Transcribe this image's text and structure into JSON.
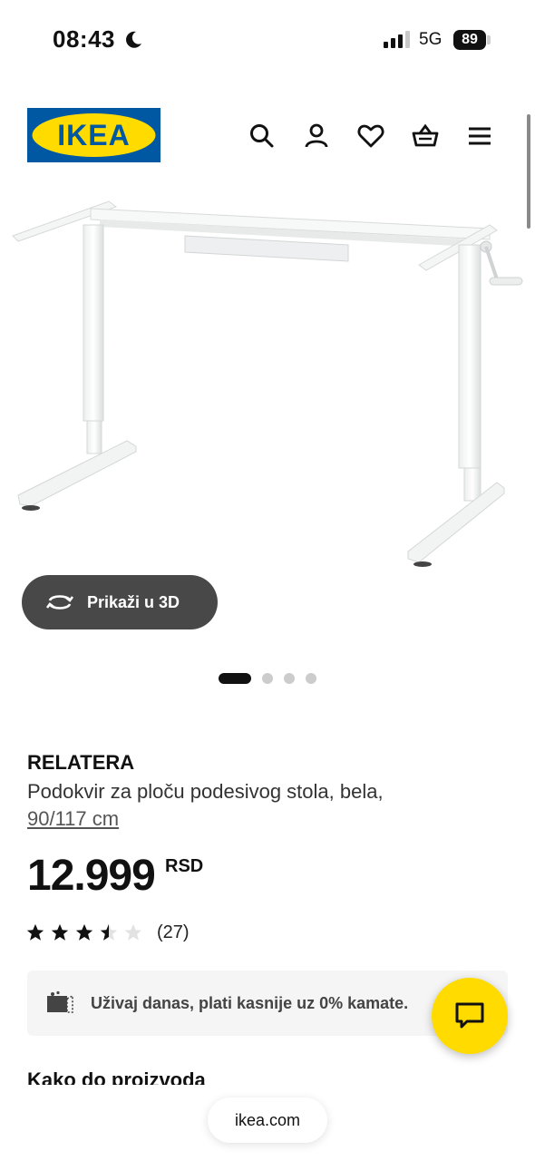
{
  "status_bar": {
    "time": "08:43",
    "network": "5G",
    "battery": "89"
  },
  "header": {
    "logo_text": "IKEA",
    "brand_colors": {
      "blue": "#0058a3",
      "yellow": "#ffdb00"
    },
    "icons": [
      "search-icon",
      "user-icon",
      "heart-icon",
      "cart-icon",
      "menu-icon"
    ]
  },
  "gallery": {
    "view_3d_label": "Prikaži u 3D",
    "slide_count": 4,
    "active_slide": 1
  },
  "product": {
    "name": "RELATERA",
    "description": "Podokvir za ploču podesivog stola, bela,",
    "size": "90/117 cm",
    "price": "12.999",
    "currency": "RSD",
    "rating": 3.5,
    "rating_max": 5,
    "review_count": "(27)"
  },
  "promo": {
    "text": "Uživaj danas, plati kasnije uz 0% kamate."
  },
  "section": {
    "heading": "Kako do proizvoda"
  },
  "browser": {
    "url": "ikea.com"
  }
}
